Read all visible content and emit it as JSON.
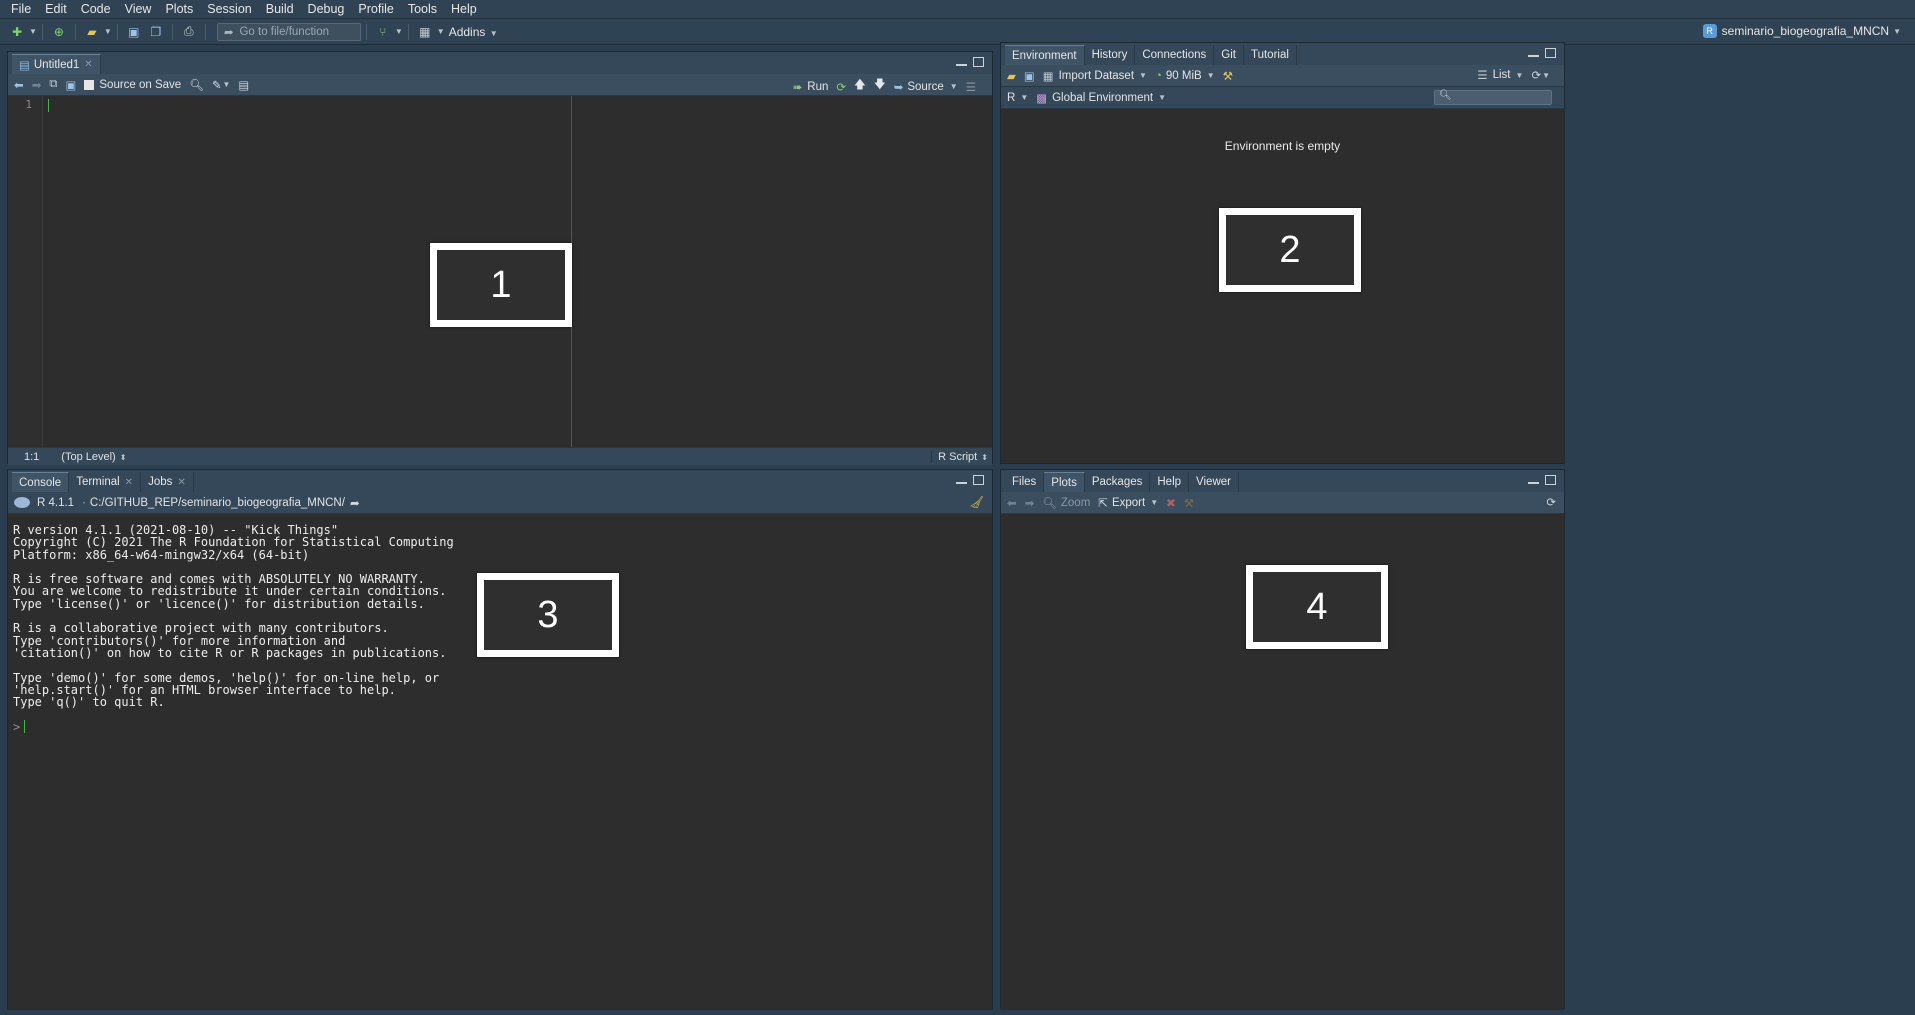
{
  "menubar": {
    "items": [
      "File",
      "Edit",
      "Code",
      "View",
      "Plots",
      "Session",
      "Build",
      "Debug",
      "Profile",
      "Tools",
      "Help"
    ]
  },
  "toolbar": {
    "goto_placeholder": "Go to file/function",
    "addins_label": "Addins",
    "project_name": "seminario_biogeografia_MNCN"
  },
  "source_pane": {
    "tabs": [
      {
        "label": "Untitled1"
      }
    ],
    "source_on_save": "Source on Save",
    "run_label": "Run",
    "source_label": "Source",
    "line_number": "1",
    "status": {
      "position": "1:1",
      "scope": "(Top Level)",
      "file_type": "R Script"
    },
    "box_label": "1"
  },
  "env_pane": {
    "tabs": [
      "Environment",
      "History",
      "Connections",
      "Git",
      "Tutorial"
    ],
    "import_dataset": "Import Dataset",
    "memory": "90 MiB",
    "list_label": "List",
    "lang": "R",
    "env_selector": "Global Environment",
    "empty_message": "Environment is empty",
    "box_label": "2"
  },
  "console_pane": {
    "tabs": [
      "Console",
      "Terminal",
      "Jobs"
    ],
    "r_version": "R 4.1.1",
    "path": "C:/GITHUB_REP/seminario_biogeografia_MNCN/",
    "output_lines": [
      "R version 4.1.1 (2021-08-10) -- \"Kick Things\"",
      "Copyright (C) 2021 The R Foundation for Statistical Computing",
      "Platform: x86_64-w64-mingw32/x64 (64-bit)",
      "",
      "R is free software and comes with ABSOLUTELY NO WARRANTY.",
      "You are welcome to redistribute it under certain conditions.",
      "Type 'license()' or 'licence()' for distribution details.",
      "",
      "R is a collaborative project with many contributors.",
      "Type 'contributors()' for more information and",
      "'citation()' on how to cite R or R packages in publications.",
      "",
      "Type 'demo()' for some demos, 'help()' for on-line help, or",
      "'help.start()' for an HTML browser interface to help.",
      "Type 'q()' to quit R."
    ],
    "prompt": ">",
    "box_label": "3"
  },
  "files_pane": {
    "tabs": [
      "Files",
      "Plots",
      "Packages",
      "Help",
      "Viewer"
    ],
    "zoom_label": "Zoom",
    "export_label": "Export",
    "box_label": "4"
  }
}
